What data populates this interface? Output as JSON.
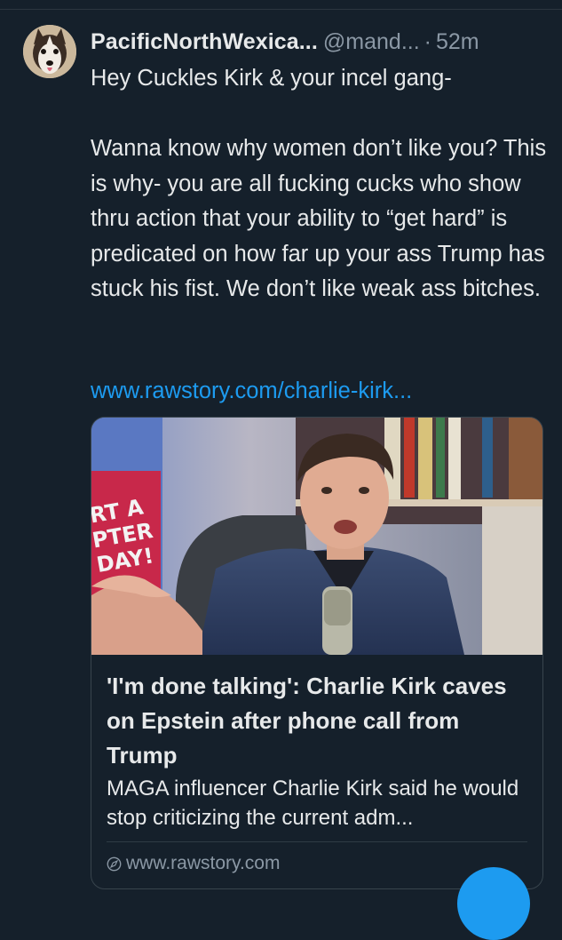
{
  "tweet": {
    "display_name": "PacificNorthWexica...",
    "handle": "@mand...",
    "separator": "·",
    "time": "52m",
    "text": "Hey Cuckles Kirk & your incel gang-\n\nWanna know why women don’t like you? This is why- you are all fucking cucks who show thru action that your ability to “get hard” is predicated on how far up your ass Trump has stuck his fist. We don’t like weak ass bitches.",
    "link": "www.rawstory.com/charlie-kirk..."
  },
  "card": {
    "title": "'I'm done talking': Charlie Kirk caves on Epstein after phone call from Trump",
    "description": "MAGA influencer Charlie Kirk said he would stop criticizing the current adm...",
    "domain": "www.rawstory.com",
    "sign_text": "RT A\nPTER\nDAY!"
  },
  "colors": {
    "background": "#15202b",
    "link": "#1d9bf0",
    "secondary_text": "#8b98a5"
  }
}
